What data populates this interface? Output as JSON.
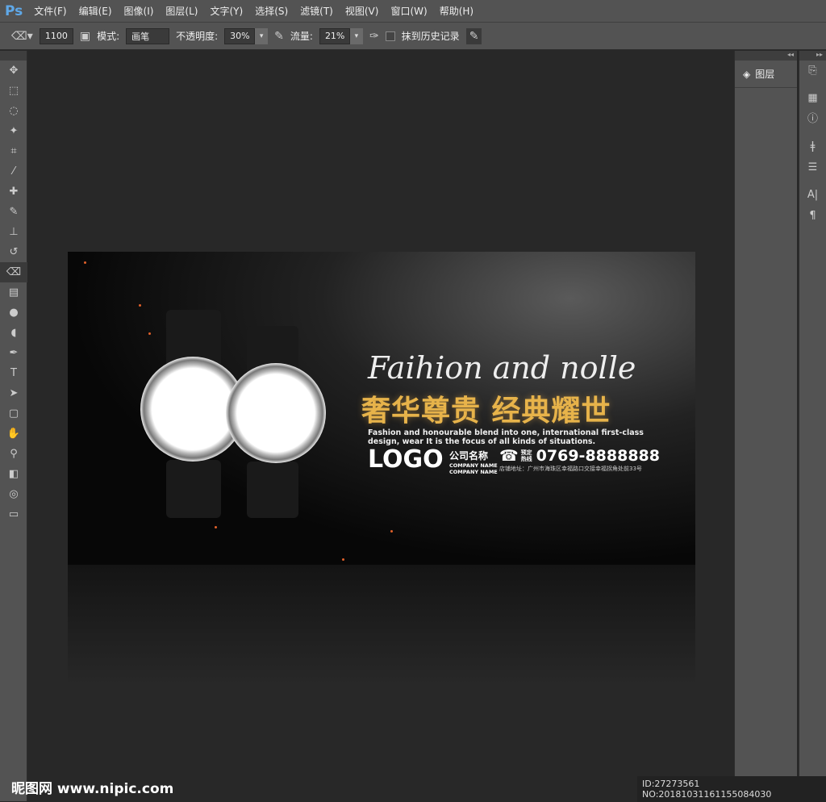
{
  "app": {
    "logo": "Ps"
  },
  "menu": [
    "文件(F)",
    "编辑(E)",
    "图像(I)",
    "图层(L)",
    "文字(Y)",
    "选择(S)",
    "滤镜(T)",
    "视图(V)",
    "窗口(W)",
    "帮助(H)"
  ],
  "options": {
    "brush_size": "1100",
    "mode_label": "模式:",
    "mode_value": "画笔",
    "opacity_label": "不透明度:",
    "opacity_value": "30%",
    "flow_label": "流量:",
    "flow_value": "21%",
    "history_label": "抹到历史记录"
  },
  "panels": {
    "layers_label": "图层"
  },
  "banner": {
    "script_title": "Faihion and nolle",
    "gold_title": "奢华尊贵 经典耀世",
    "english": "Fashion and honourable blend into one, international first-class design, wear It is the focus of all kinds of situations.",
    "logo": "LOGO",
    "company": "公司名称",
    "company_en1": "COMPANY NAME",
    "company_en2": "COMPANY NAME",
    "phone_label": "预定热线",
    "phone": "0769-8888888",
    "address": "店铺地址：广州市海珠区幸福路口交接幸福拐角处前33号"
  },
  "watermark": {
    "site": "昵图网 www.nipic.com",
    "id": "ID:27273561 NO:20181031161155084030"
  }
}
